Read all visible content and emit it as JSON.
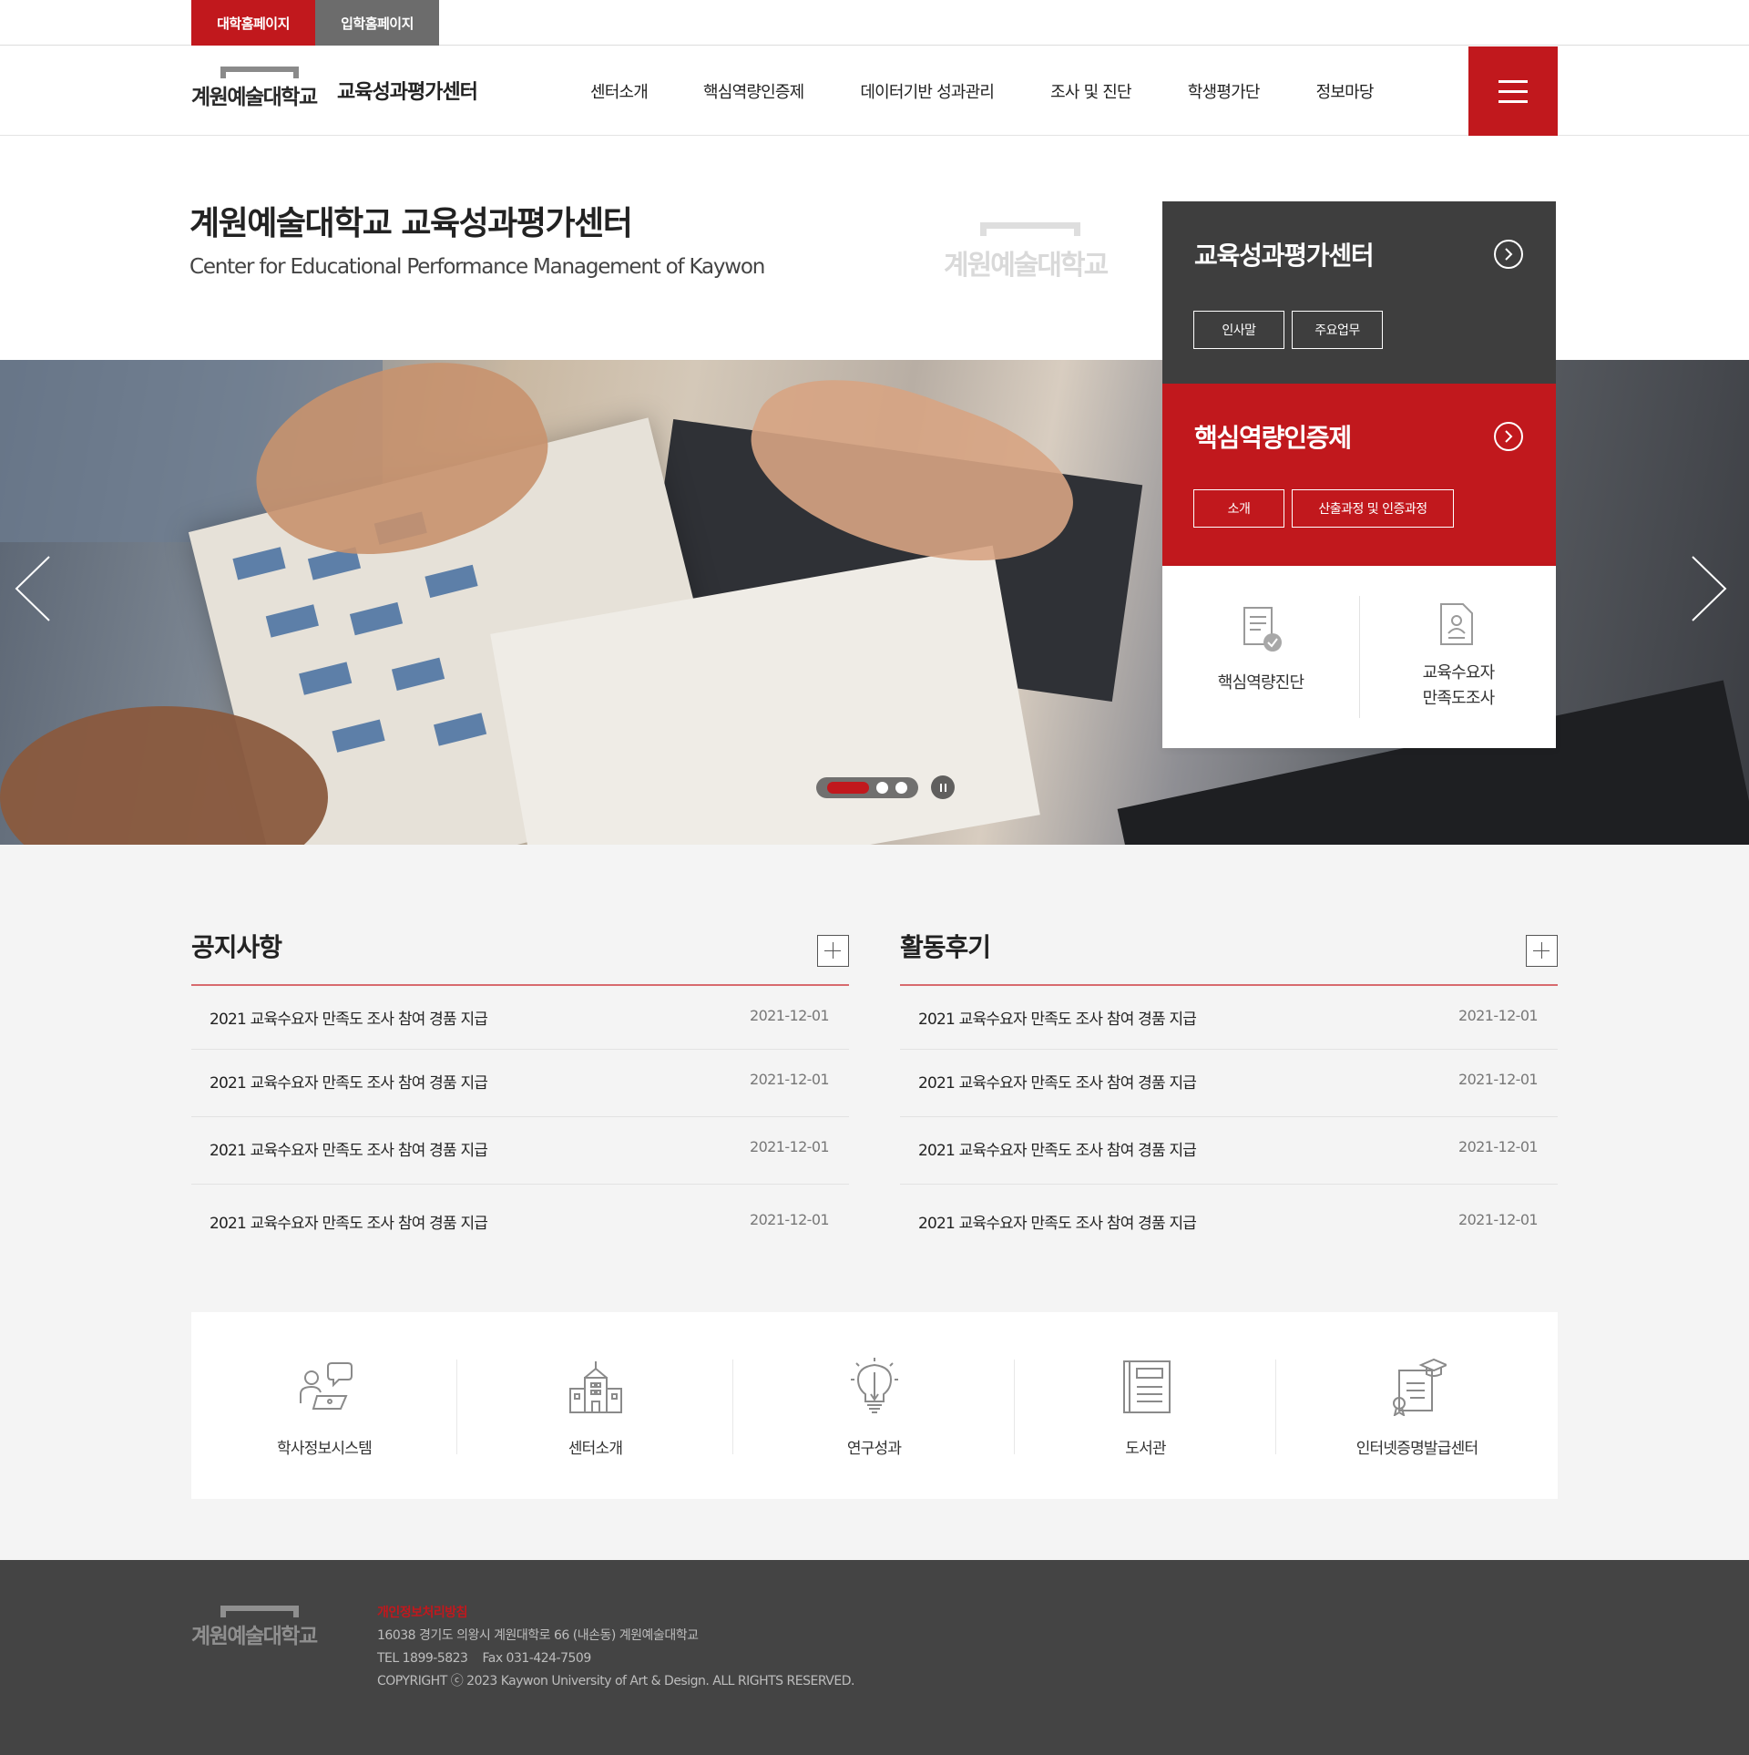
{
  "util": {
    "univ_home": "대학홈페이지",
    "admission_home": "입학홈페이지"
  },
  "header": {
    "logo_text": "계원예술대학교",
    "center_title": "교육성과평가센터",
    "nav": [
      "센터소개",
      "핵심역량인증제",
      "데이터기반 성과관리",
      "조사 및 진단",
      "학생평가단",
      "정보마당"
    ],
    "menu_icon": "hamburger-icon"
  },
  "hero": {
    "title_light": "계원예술대학교 ",
    "title_bold": "교육성과평가센터",
    "subtitle": "Center for Educational Performance Management of Kaywon",
    "watermark_text": "계원예술대학교"
  },
  "slider": {
    "slide_count": 3,
    "active_slide": 1
  },
  "panel": {
    "center": {
      "title": "교육성과평가센터",
      "buttons": [
        "인사말",
        "주요업무"
      ]
    },
    "certification": {
      "title": "핵심역량인증제",
      "buttons": [
        "소개",
        "산출과정 및 인증과정"
      ]
    },
    "shortcuts": [
      "핵심역량진단",
      "교육수요자",
      "만족도조사"
    ]
  },
  "notice": {
    "title": "공지사항",
    "items": [
      {
        "title": "2021 교육수요자 만족도 조사 참여 경품 지급",
        "date": "2021-12-01"
      },
      {
        "title": "2021 교육수요자 만족도 조사 참여 경품 지급",
        "date": "2021-12-01"
      },
      {
        "title": "2021 교육수요자 만족도 조사 참여 경품 지급",
        "date": "2021-12-01"
      },
      {
        "title": "2021 교육수요자 만족도 조사 참여 경품 지급",
        "date": "2021-12-01"
      }
    ]
  },
  "review": {
    "title": "활동후기",
    "items": [
      {
        "title": "2021 교육수요자 만족도 조사 참여 경품 지급",
        "date": "2021-12-01"
      },
      {
        "title": "2021 교육수요자 만족도 조사 참여 경품 지급",
        "date": "2021-12-01"
      },
      {
        "title": "2021 교육수요자 만족도 조사 참여 경품 지급",
        "date": "2021-12-01"
      },
      {
        "title": "2021 교육수요자 만족도 조사 참여 경품 지급",
        "date": "2021-12-01"
      }
    ]
  },
  "quick_links": [
    {
      "label": "학사정보시스템",
      "icon": "person-laptop-icon"
    },
    {
      "label": "센터소개",
      "icon": "building-icon"
    },
    {
      "label": "연구성과",
      "icon": "lightbulb-icon"
    },
    {
      "label": "도서관",
      "icon": "book-icon"
    },
    {
      "label": "인터넷증명발급센터",
      "icon": "certificate-icon"
    }
  ],
  "footer": {
    "logo_text": "계원예술대학교",
    "privacy": "개인정보처리방침",
    "address": "16038 경기도 의왕시 계원대학로 66 (내손동) 계원예술대학교",
    "tel": "TEL 1899-5823",
    "fax": "Fax 031-424-7509",
    "copyright": "COPYRIGHT ⓒ 2023 Kaywon University of Art & Design.  ALL RIGHTS RESERVED."
  },
  "colors": {
    "brand_red": "#c1181d",
    "dark_panel": "#3e3e3e",
    "footer_bg": "#444444"
  }
}
